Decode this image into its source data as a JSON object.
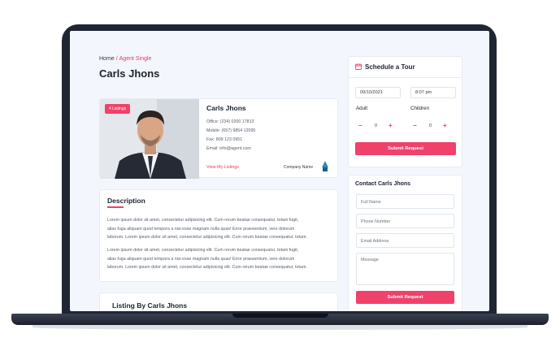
{
  "breadcrumb": {
    "home": "Home",
    "separator": "/",
    "current": "Agent Single"
  },
  "page_title": "Carls Jhons",
  "agent": {
    "badge": "4 Listings",
    "name": "Carls Jhons",
    "office": "Office: (234) 0200 17813",
    "mobile": "Mobile: (657) 9854 12095",
    "fax": "Fax: 809 123 0951",
    "email": "Email: info@agent.com",
    "listings_link": "View My Listings",
    "company": "Company Name"
  },
  "description": {
    "title": "Description",
    "paragraph1": [
      "Lorem ipsum dolor sit amet, consectetur adipisicing elit. Cum rerum beatae consequatur, totam fugit,",
      "alias fuga aliquam quod tempora a nisi esse magnam nulla quas! Error praesentium, vero dolorum",
      "laborum. Lorem ipsum dolor sit amet, consectetur adipisicing elit. Cum rerum beatae consequatur, totam."
    ],
    "paragraph2": [
      "Lorem ipsum dolor sit amet, consectetur adipisicing elit. Cum rerum beatae consequatur, totam fugit,",
      "alias fuga aliquam quod tempora a nisi esse magnam nulla quas! Error praesentium, vero dolorum",
      "laborum. Lorem ipsum dolor sit amet, consectetur adipisicing elit. Cum rerum beatae consequatur, totam."
    ]
  },
  "listing_section": {
    "title": "Listing By Carls Jhons"
  },
  "tour": {
    "title": "Schedule a Tour",
    "date_value": "09/10/2021",
    "time_value": "8:07 pm",
    "adult_label": "Adult",
    "adult_value": "0",
    "children_label": "Children",
    "children_value": "0",
    "minus_symbol": "−",
    "plus_symbol": "+",
    "submit": "Submit Request"
  },
  "contact": {
    "title": "Contact Carls Jhons",
    "full_name_placeholder": "Full Name",
    "phone_placeholder": "Phone Number",
    "email_placeholder": "Email Address",
    "message_placeholder": "Message",
    "submit": "Submit Request"
  },
  "colors": {
    "accent": "#f0416b",
    "heading": "#1b2230",
    "page_bg": "#f3f7fd",
    "laptop_bezel": "#1f2533"
  }
}
